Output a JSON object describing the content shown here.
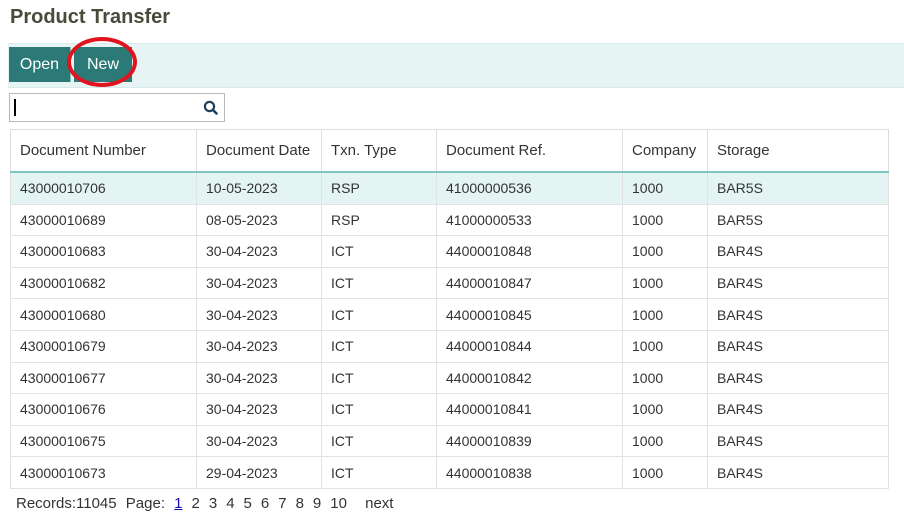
{
  "page": {
    "title": "Product Transfer"
  },
  "toolbar": {
    "open_label": "Open",
    "new_label": "New",
    "accent_color": "#2b7a78",
    "highlight_color": "#e0141e"
  },
  "search": {
    "value": "",
    "placeholder": "",
    "icon": "search-icon"
  },
  "table": {
    "columns": [
      "Document Number",
      "Document Date",
      "Txn. Type",
      "Document Ref.",
      "Company",
      "Storage"
    ],
    "rows": [
      [
        "43000010706",
        "10-05-2023",
        "RSP",
        "41000000536",
        "1000",
        "BAR5S"
      ],
      [
        "43000010689",
        "08-05-2023",
        "RSP",
        "41000000533",
        "1000",
        "BAR5S"
      ],
      [
        "43000010683",
        "30-04-2023",
        "ICT",
        "44000010848",
        "1000",
        "BAR4S"
      ],
      [
        "43000010682",
        "30-04-2023",
        "ICT",
        "44000010847",
        "1000",
        "BAR4S"
      ],
      [
        "43000010680",
        "30-04-2023",
        "ICT",
        "44000010845",
        "1000",
        "BAR4S"
      ],
      [
        "43000010679",
        "30-04-2023",
        "ICT",
        "44000010844",
        "1000",
        "BAR4S"
      ],
      [
        "43000010677",
        "30-04-2023",
        "ICT",
        "44000010842",
        "1000",
        "BAR4S"
      ],
      [
        "43000010676",
        "30-04-2023",
        "ICT",
        "44000010841",
        "1000",
        "BAR4S"
      ],
      [
        "43000010675",
        "30-04-2023",
        "ICT",
        "44000010839",
        "1000",
        "BAR4S"
      ],
      [
        "43000010673",
        "29-04-2023",
        "ICT",
        "44000010838",
        "1000",
        "BAR4S"
      ]
    ],
    "selected_row": 0
  },
  "pager": {
    "records_label": "Records:11045",
    "page_label": "Page:",
    "pages": [
      "1",
      "2",
      "3",
      "4",
      "5",
      "6",
      "7",
      "8",
      "9",
      "10"
    ],
    "current_page": "1",
    "next_label": "next"
  }
}
